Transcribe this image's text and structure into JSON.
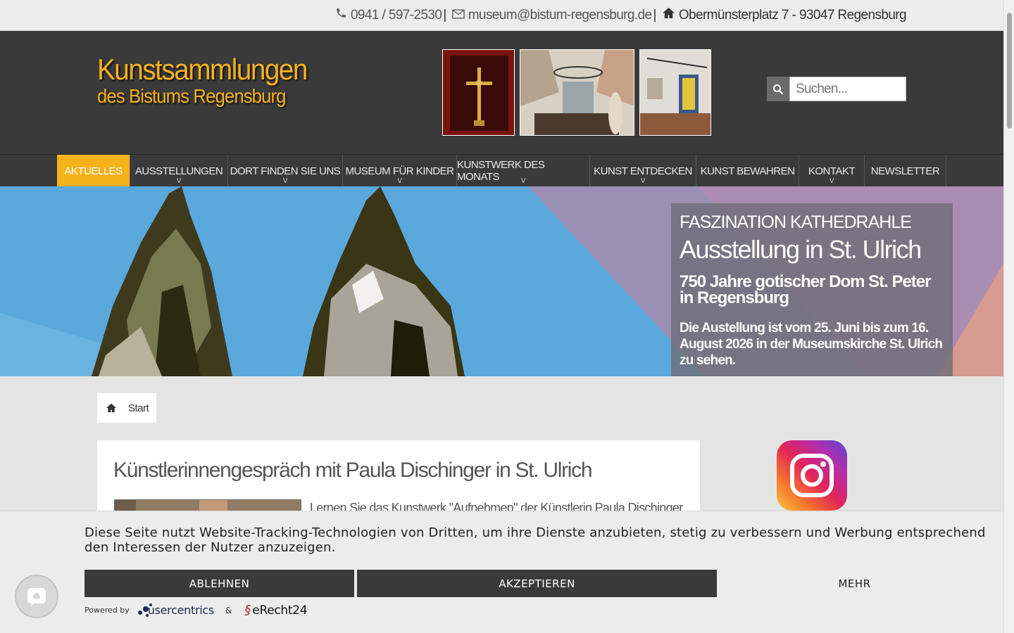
{
  "topbar": {
    "phone": "0941 / 597-2530",
    "email": "museum@bistum-regensburg.de",
    "address": "Obermünsterplatz 7 - 93047 Regensburg",
    "separator": "|"
  },
  "logo": {
    "line1": "Kunstsammlungen",
    "line2": "des Bistums Regensburg"
  },
  "search": {
    "placeholder": "Suchen..."
  },
  "nav": {
    "items": [
      {
        "label": "AKTUELLES"
      },
      {
        "label": "AUSSTELLUNGEN"
      },
      {
        "label": "DORT FINDEN SIE UNS"
      },
      {
        "label": "MUSEUM FÜR KINDER"
      },
      {
        "label": "KUNSTWERK DES MONATS"
      },
      {
        "label": "KUNST ENTDECKEN"
      },
      {
        "label": "KUNST BEWAHREN"
      },
      {
        "label": "KONTAKT"
      },
      {
        "label": "NEWSLETTER"
      }
    ]
  },
  "hero": {
    "kicker": "FASZINATION KATHEDRAHLE",
    "title": "Ausstellung in St. Ulrich",
    "subtitle": "750 Jahre gotischer Dom St. Peter in Regensburg",
    "body": "Die Austellung ist vom 25. Juni  bis zum 16. August 2026 in der Museumskirche St. Ulrich zu sehen."
  },
  "breadcrumb": {
    "start": "Start"
  },
  "article": {
    "title": "Künstlerinnengespräch mit Paula Dischinger in St. Ulrich",
    "teaser": "Lernen Sie das Kunstwerk \"Aufnehmen\" der Künstlerin Paula Dischinger"
  },
  "cookie": {
    "message": "Diese Seite nutzt Website-Tracking-Technologien von Dritten, um ihre Dienste anzubieten, stetig zu verbessern und Werbung entsprechend den Interessen der Nutzer anzuzeigen.",
    "decline": "ABLEHNEN",
    "accept": "AKZEPTIEREN",
    "more": "MEHR",
    "powered_by": "Powered by",
    "usercentrics": "usercentrics",
    "amp": "&",
    "erecht": "eRecht24"
  },
  "colors": {
    "accent": "#f6b21b",
    "header_bg": "#3a3a3a",
    "hero_sky": "#5aa8dc"
  }
}
